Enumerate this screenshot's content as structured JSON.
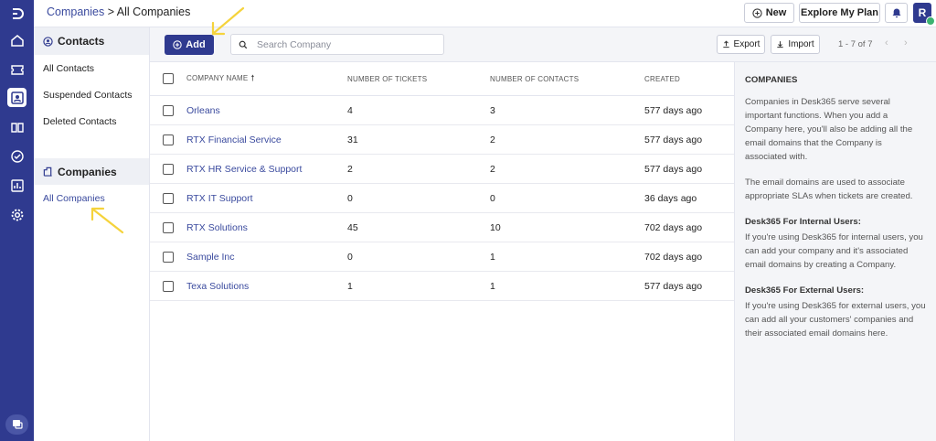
{
  "header": {
    "breadcrumb_link": "Companies",
    "breadcrumb_sep": " > ",
    "breadcrumb_current": "All Companies",
    "new_label": "New",
    "explore_label": "Explore My Plan",
    "avatar_initial": "R"
  },
  "sidebar": {
    "contacts_heading": "Contacts",
    "contacts_items": [
      "All Contacts",
      "Suspended Contacts",
      "Deleted Contacts"
    ],
    "companies_heading": "Companies",
    "companies_items": [
      "All Companies"
    ]
  },
  "toolbar": {
    "add_label": "Add",
    "search_placeholder": "Search Company",
    "export_label": "Export",
    "import_label": "Import",
    "pager": "1 - 7 of 7"
  },
  "table": {
    "columns": [
      "COMPANY NAME",
      "NUMBER OF TICKETS",
      "NUMBER OF CONTACTS",
      "CREATED"
    ],
    "rows": [
      {
        "name": "Orleans",
        "tickets": "4",
        "contacts": "3",
        "created": "577 days ago"
      },
      {
        "name": "RTX Financial Service",
        "tickets": "31",
        "contacts": "2",
        "created": "577 days ago"
      },
      {
        "name": "RTX HR Service & Support",
        "tickets": "2",
        "contacts": "2",
        "created": "577 days ago"
      },
      {
        "name": "RTX IT Support",
        "tickets": "0",
        "contacts": "0",
        "created": "36 days ago"
      },
      {
        "name": "RTX Solutions",
        "tickets": "45",
        "contacts": "10",
        "created": "702 days ago"
      },
      {
        "name": "Sample Inc",
        "tickets": "0",
        "contacts": "1",
        "created": "702 days ago"
      },
      {
        "name": "Texa Solutions",
        "tickets": "1",
        "contacts": "1",
        "created": "577 days ago"
      }
    ]
  },
  "info": {
    "title": "COMPANIES",
    "p1": "Companies in Desk365 serve several important functions. When you add a Company here, you'll also be adding all the email domains that the Company is associated with.",
    "p2": "The email domains are used to associate appropriate SLAs when tickets are created.",
    "internal_title": "Desk365 For Internal Users:",
    "internal_text": "If you're using Desk365 for internal users, you can add your company and it's associated email domains by creating a Company.",
    "external_title": "Desk365 For External Users:",
    "external_text": "If you're using Desk365 for external users, you can add all your customers' companies and their associated email domains here."
  },
  "colors": {
    "brand": "#2f3a8f",
    "link": "#3a4a9e",
    "annotation": "#f5d33c"
  }
}
